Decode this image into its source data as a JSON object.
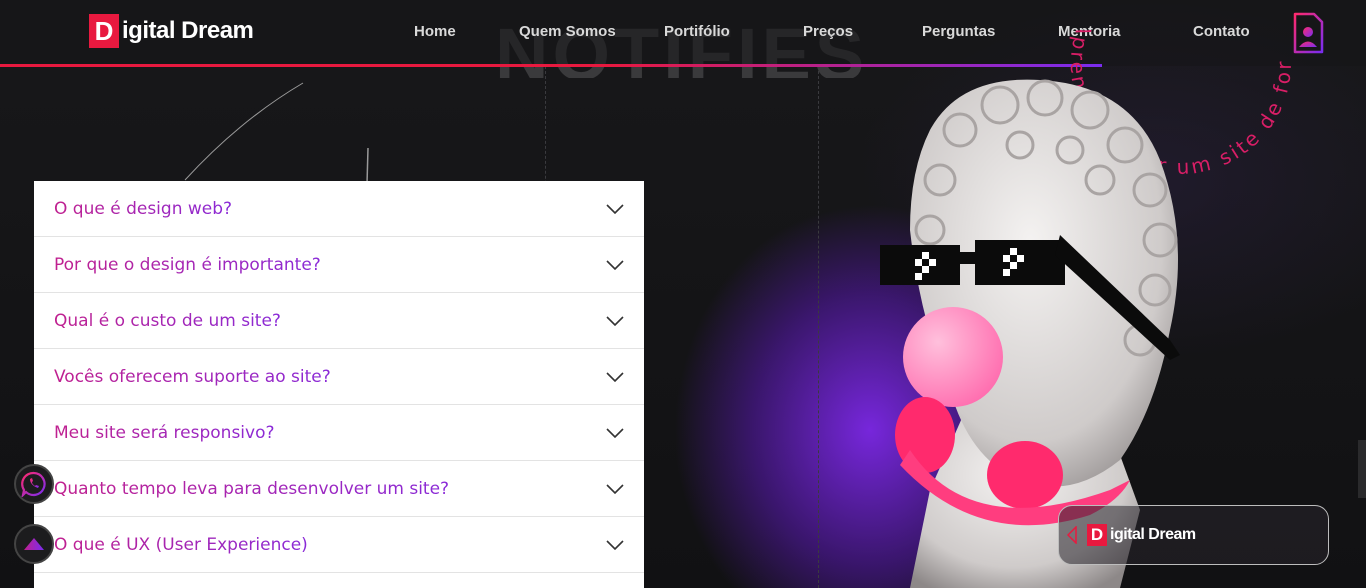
{
  "header": {
    "logo_letter": "D",
    "logo_text": "igital Dream",
    "nav": [
      "Home",
      "Quem Somos",
      "Portifólio",
      "Preços",
      "Perguntas",
      "Mentoria",
      "Contato"
    ]
  },
  "hero": {
    "big_word": "NOTIFIES",
    "circle_text": "Aprenda a fazer um site de forma gratuito gratis"
  },
  "faq": {
    "items": [
      "O que é design web?",
      "Por que o design é importante?",
      "Qual é o custo de um site?",
      "Vocês oferecem suporte ao site?",
      "Meu site será responsivo?",
      "Quanto tempo leva para desenvolver um site?",
      "O que é UX (User Experience)"
    ]
  },
  "card": {
    "logo_letter": "D",
    "logo_text": "igital Dream"
  },
  "colors": {
    "accent_red": "#e8193f",
    "accent_purple": "#7a2cf0",
    "faq_text_start": "#c0208f",
    "faq_text_end": "#8a2ad8"
  },
  "icons": [
    "profile-icon",
    "whatsapp-icon",
    "scroll-top-icon",
    "chevron-down-icon",
    "chevron-left-icon"
  ]
}
